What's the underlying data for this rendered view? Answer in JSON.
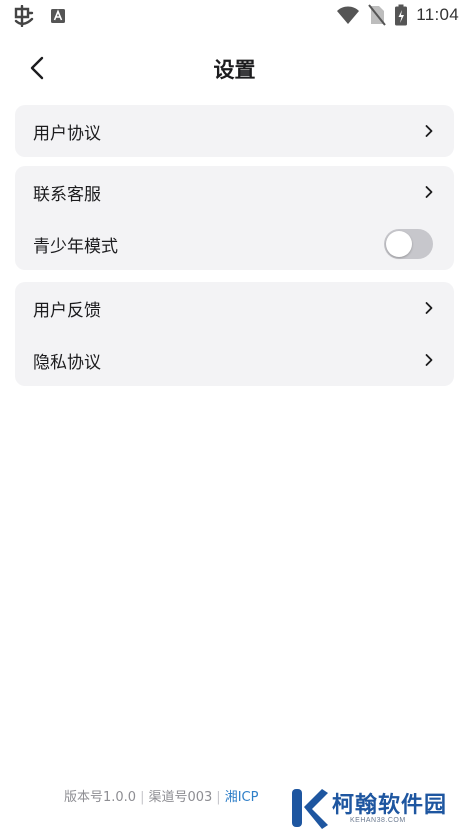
{
  "status_bar": {
    "time": "11:04",
    "icons": [
      "bug-icon",
      "font-a-icon",
      "wifi-icon",
      "no-sim-icon",
      "battery-charging-icon"
    ]
  },
  "header": {
    "title": "设置",
    "back_icon": "chevron-left-icon"
  },
  "groups": [
    {
      "items": [
        {
          "label": "用户协议",
          "control": "chevron"
        }
      ]
    },
    {
      "items": [
        {
          "label": "联系客服",
          "control": "chevron"
        },
        {
          "label": "青少年模式",
          "control": "toggle",
          "toggle_on": false
        }
      ]
    },
    {
      "items": [
        {
          "label": "用户反馈",
          "control": "chevron"
        },
        {
          "label": "隐私协议",
          "control": "chevron"
        }
      ]
    }
  ],
  "footer": {
    "version": "版本号1.0.0",
    "channel": "渠道号003",
    "icp": "湘ICP"
  },
  "watermark": {
    "text": "柯翰软件园",
    "sub": "KEHAN38.COM"
  },
  "colors": {
    "card_bg": "#f3f3f5",
    "toggle_off": "#c7c7cc",
    "icp_link": "#2f7fc8",
    "watermark_blue": "#1e56a0"
  }
}
